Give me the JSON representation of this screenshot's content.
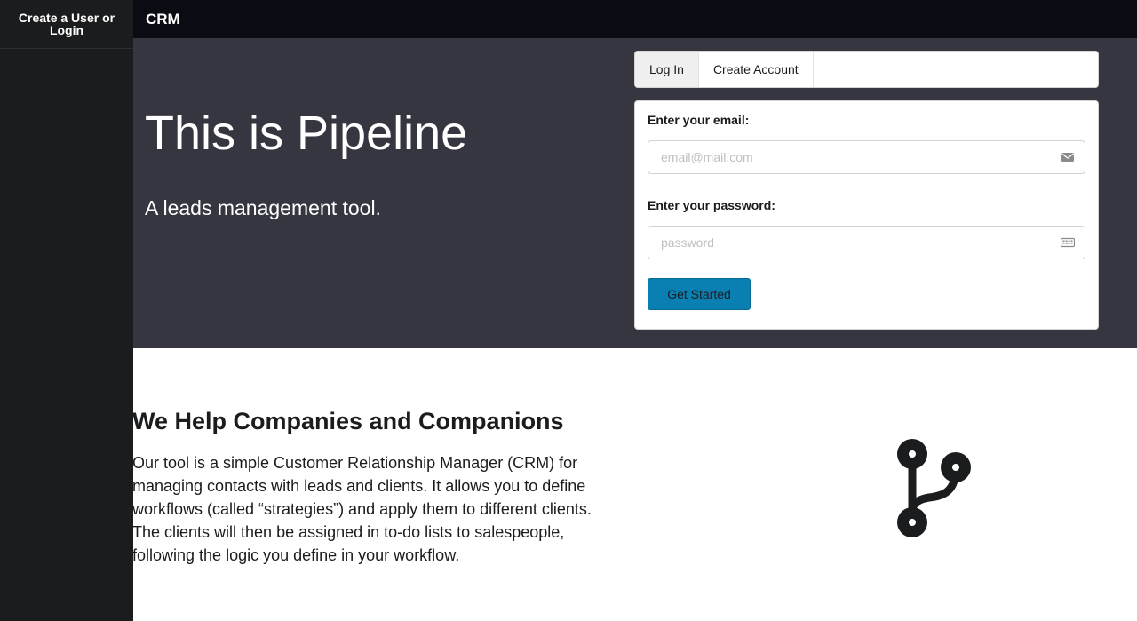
{
  "sidebar": {
    "items": [
      {
        "label": "Create a User or Login"
      }
    ]
  },
  "topbar": {
    "brand": "CRM"
  },
  "hero": {
    "title": "This is Pipeline",
    "subtitle": "A leads management tool."
  },
  "auth": {
    "tabs": [
      {
        "label": "Log In",
        "active": true
      },
      {
        "label": "Create Account",
        "active": false
      }
    ],
    "email": {
      "label": "Enter your email:",
      "placeholder": "email@mail.com",
      "value": "",
      "icon": "envelope-icon"
    },
    "password": {
      "label": "Enter your password:",
      "placeholder": "password",
      "value": "",
      "icon": "keyboard-icon"
    },
    "submit_label": "Get Started"
  },
  "section": {
    "title": "We Help Companies and Companions",
    "body": "Our tool is a simple Customer Relationship Manager (CRM) for managing contacts with leads and clients. It allows you to define workflows (called “strategies”) and apply them to different clients. The clients will then be assigned in to-do lists to salespeople, following the logic you define in your workflow.",
    "icon": "code-branch-icon"
  },
  "colors": {
    "sidebar_bg": "#1b1c1d",
    "topbar_bg": "#0b0b14",
    "hero_bg": "#35363f",
    "accent": "#0a7fb1"
  }
}
